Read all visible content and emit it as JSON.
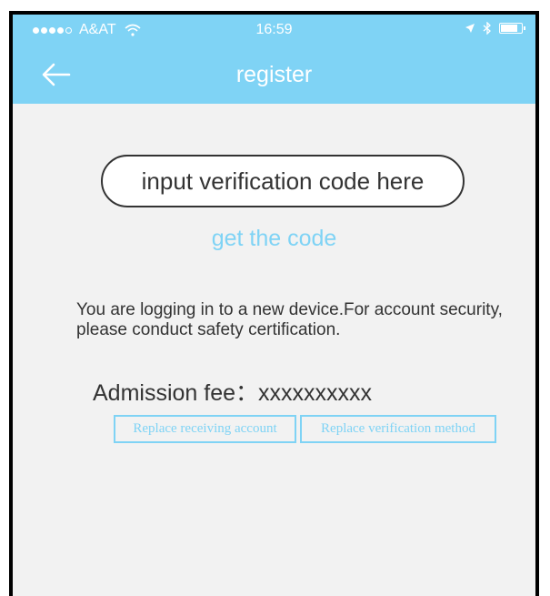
{
  "status_bar": {
    "carrier": "A&AT",
    "time": "16:59",
    "icons": [
      "signal-dots-icon",
      "wifi-icon",
      "location-arrow-icon",
      "bluetooth-icon",
      "battery-icon"
    ],
    "battery_level": 0.8
  },
  "nav": {
    "title": "register",
    "back_icon": "back-arrow-icon"
  },
  "form": {
    "code_placeholder": "input verification code here",
    "code_value": "",
    "get_code_label": "get the code"
  },
  "notice": "You are logging in to a new device.For account security, please conduct safety certification.",
  "fee_text": "Admission fee：xxxxxxxxxx",
  "buttons": {
    "replace_account": "Replace receiving account",
    "replace_method": "Replace verification method"
  },
  "colors": {
    "accent": "#7fd3f5",
    "background": "#f2f2f2",
    "text": "#333333"
  }
}
